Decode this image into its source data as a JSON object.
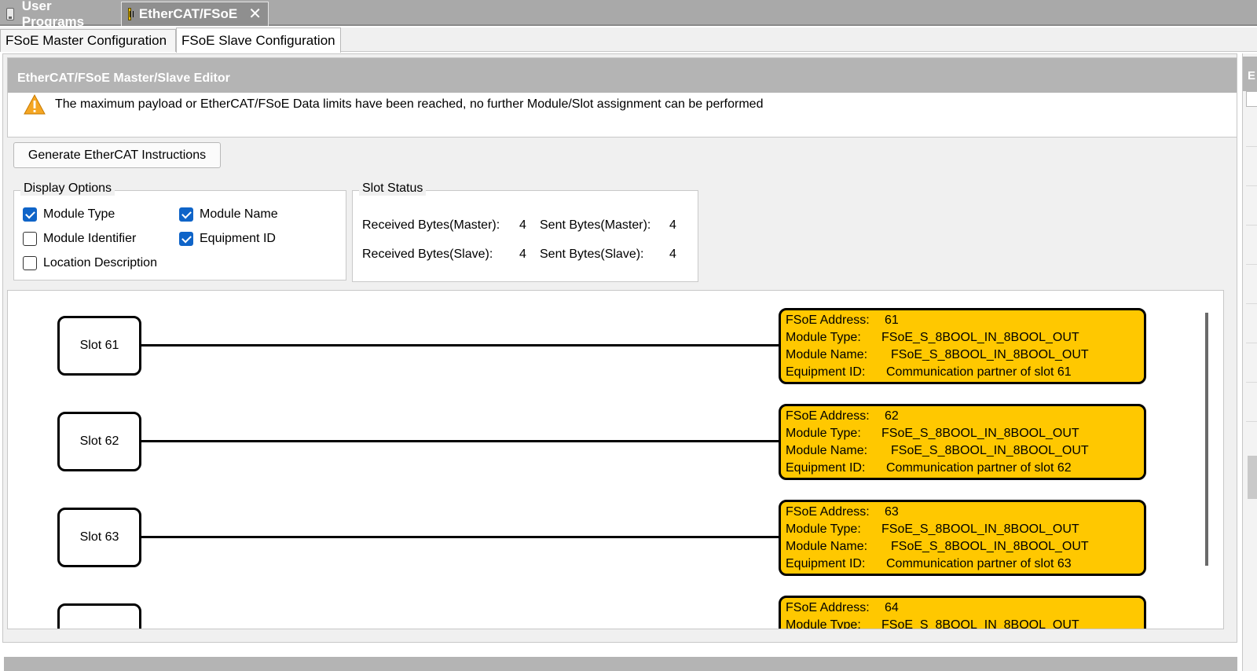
{
  "doc_tabs": [
    {
      "label": "User Programs",
      "icon": "program-icon"
    },
    {
      "label": "EtherCAT/FSoE",
      "icon": "ethercat-icon",
      "close": "✕"
    }
  ],
  "sub_tabs": [
    {
      "label": "FSoE Master Configuration"
    },
    {
      "label": "FSoE Slave Configuration"
    }
  ],
  "editor": {
    "title": "EtherCAT/FSoE Master/Slave Editor",
    "warning": "The maximum payload or EtherCAT/FSoE Data limits have been reached, no further Module/Slot assignment can be performed",
    "generate_button": "Generate EtherCAT Instructions"
  },
  "display_options": {
    "legend": "Display Options",
    "items": [
      {
        "label": "Module Type",
        "checked": true
      },
      {
        "label": "Module Name",
        "checked": true
      },
      {
        "label": "Module Identifier",
        "checked": false
      },
      {
        "label": "Equipment ID",
        "checked": true
      },
      {
        "label": "Location Description",
        "checked": false
      }
    ]
  },
  "slot_status": {
    "legend": "Slot Status",
    "received_master_label": "Received Bytes(Master):",
    "received_master_value": "4",
    "sent_master_label": "Sent Bytes(Master):",
    "sent_master_value": "4",
    "received_slave_label": "Received Bytes(Slave):",
    "received_slave_value": "4",
    "sent_slave_label": "Sent Bytes(Slave):",
    "sent_slave_value": "4"
  },
  "diagram": {
    "labels": {
      "address": "FSoE Address:",
      "type": "Module Type:",
      "name": "Module Name:",
      "equipment": "Equipment ID:"
    },
    "slots": [
      {
        "slot": "Slot 61",
        "address": "61",
        "type": "FSoE_S_8BOOL_IN_8BOOL_OUT",
        "name": "FSoE_S_8BOOL_IN_8BOOL_OUT",
        "equipment": "Communication partner of slot 61"
      },
      {
        "slot": "Slot 62",
        "address": "62",
        "type": "FSoE_S_8BOOL_IN_8BOOL_OUT",
        "name": "FSoE_S_8BOOL_IN_8BOOL_OUT",
        "equipment": "Communication partner of slot 62"
      },
      {
        "slot": "Slot 63",
        "address": "63",
        "type": "FSoE_S_8BOOL_IN_8BOOL_OUT",
        "name": "FSoE_S_8BOOL_IN_8BOOL_OUT",
        "equipment": "Communication partner of slot 63"
      },
      {
        "slot": "",
        "address": "64",
        "type": "FSoE_S_8BOOL_IN_8BOOL_OUT"
      }
    ]
  },
  "right_panel": {
    "title": "E"
  },
  "colors": {
    "module_fill": "#ffc800",
    "title_bar": "#b4b4b4",
    "checkbox_on": "#0f64c8"
  }
}
